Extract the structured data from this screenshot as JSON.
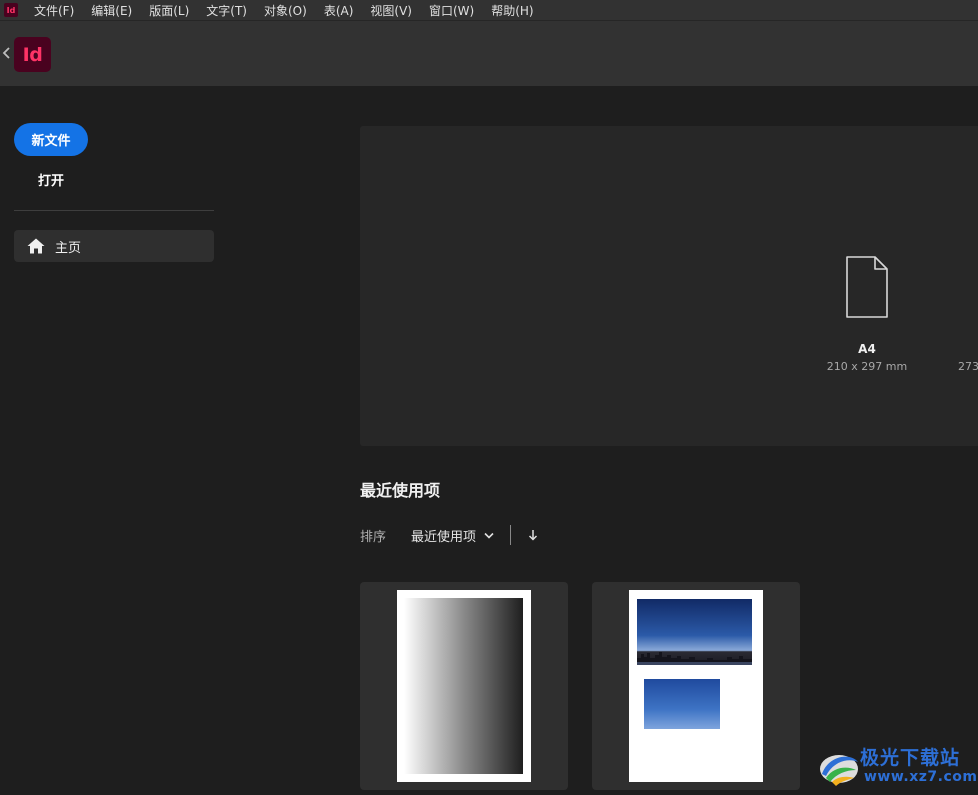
{
  "menubar": {
    "app_badge": "Id",
    "items": [
      {
        "label": "文件(F)"
      },
      {
        "label": "编辑(E)"
      },
      {
        "label": "版面(L)"
      },
      {
        "label": "文字(T)"
      },
      {
        "label": "对象(O)"
      },
      {
        "label": "表(A)"
      },
      {
        "label": "视图(V)"
      },
      {
        "label": "窗口(W)"
      },
      {
        "label": "帮助(H)"
      }
    ]
  },
  "header": {
    "logo_text": "Id",
    "logo_icon": "indesign-logo",
    "back_icon": "chevron-left-icon"
  },
  "sidebar": {
    "new_file_label": "新文件",
    "open_label": "打开",
    "home_label": "主页",
    "home_icon": "home-icon"
  },
  "presets": {
    "items": [
      {
        "name": "A4",
        "dims": "210 x 297 mm",
        "icon": "document-icon"
      }
    ],
    "partial_next": "273"
  },
  "recent": {
    "title": "最近使用项",
    "sort_label": "排序",
    "sort_value": "最近使用项",
    "sort_direction_icon": "arrow-down-icon",
    "files": [
      {
        "thumbnail": "gradient-page"
      },
      {
        "thumbnail": "photo-page"
      }
    ]
  },
  "watermark": {
    "title": "极光下载站",
    "url": "www.xz7.com"
  },
  "colors": {
    "accent": "#1473e6",
    "background": "#1e1e1e",
    "panel": "#272727",
    "indesign_brand": "#ff3366"
  }
}
